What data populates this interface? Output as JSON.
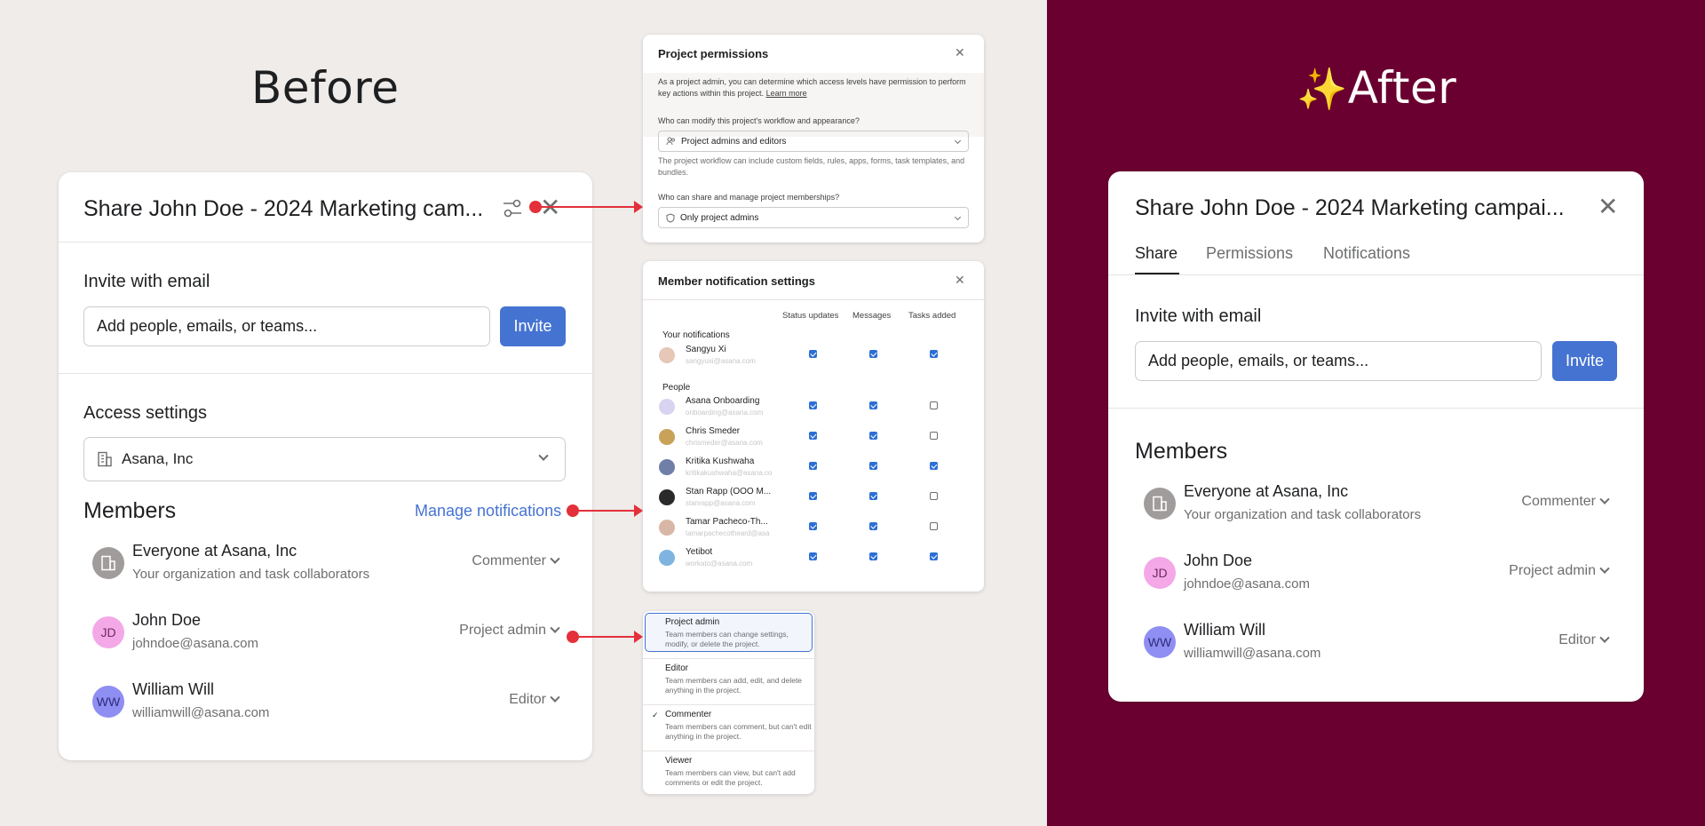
{
  "headings": {
    "before": "Before",
    "after_sparkle": "✨",
    "after": "After"
  },
  "before": {
    "title": "Share John Doe - 2024 Marketing cam...",
    "invite_label": "Invite with email",
    "invite_placeholder": "Add people, emails, or teams...",
    "invite_button": "Invite",
    "access_label": "Access settings",
    "access_value": "Asana, Inc",
    "members_label": "Members",
    "manage_notifications": "Manage notifications",
    "members": [
      {
        "name": "Everyone at Asana, Inc",
        "sub": "Your organization and task collaborators",
        "role": "Commenter",
        "initials": ""
      },
      {
        "name": "John Doe",
        "sub": "johndoe@asana.com",
        "role": "Project admin",
        "initials": "JD"
      },
      {
        "name": "William Will",
        "sub": "williamwill@asana.com",
        "role": "Editor",
        "initials": "WW"
      }
    ]
  },
  "permissions_panel": {
    "title": "Project permissions",
    "intro": "As a project admin, you can determine which access levels have permission to perform key actions within this project.",
    "learn_more": "Learn more",
    "q1": "Who can modify this project's workflow and appearance?",
    "q1_value": "Project admins and editors",
    "q1_note": "The project workflow can include custom fields, rules, apps, forms, task templates, and bundles.",
    "q2": "Who can share and manage project memberships?",
    "q2_value": "Only project admins"
  },
  "notifications_panel": {
    "title": "Member notification settings",
    "columns": [
      "Status updates",
      "Messages",
      "Tasks added"
    ],
    "your_section": "Your notifications",
    "people_section": "People",
    "rows": [
      {
        "name": "Sangyu Xi",
        "email": "sangyuxi@asana.com",
        "checks": [
          true,
          true,
          true
        ],
        "color": "#e6c7b8"
      },
      {
        "name": "Asana Onboarding",
        "email": "onboarding@asana.com",
        "checks": [
          true,
          true,
          false
        ],
        "color": "#d9d3f2"
      },
      {
        "name": "Chris Smeder",
        "email": "chrismeder@asana.com",
        "checks": [
          true,
          true,
          false
        ],
        "color": "#c9a25a"
      },
      {
        "name": "Kritika Kushwaha",
        "email": "kritikakushwaha@asana.co",
        "checks": [
          true,
          true,
          true
        ],
        "color": "#6f7fa8"
      },
      {
        "name": "Stan Rapp (OOO M...",
        "email": "stanrapp@asana.com",
        "checks": [
          true,
          true,
          false
        ],
        "color": "#2a2a2a"
      },
      {
        "name": "Tamar Pacheco-Th...",
        "email": "tamarpachecotheard@asa",
        "checks": [
          true,
          true,
          false
        ],
        "color": "#d9b7a6"
      },
      {
        "name": "Yetibot",
        "email": "workato@asana.com",
        "checks": [
          true,
          true,
          true
        ],
        "color": "#7fb3e0"
      }
    ]
  },
  "roles_panel": {
    "items": [
      {
        "title": "Project admin",
        "desc": "Team members can change settings, modify, or delete the project.",
        "selected": true,
        "checked": false
      },
      {
        "title": "Editor",
        "desc": "Team members can add, edit, and delete anything in the project.",
        "selected": false,
        "checked": false
      },
      {
        "title": "Commenter",
        "desc": "Team members can comment, but can't edit anything in the project.",
        "selected": false,
        "checked": true
      },
      {
        "title": "Viewer",
        "desc": "Team members can view, but can't add comments or edit the project.",
        "selected": false,
        "checked": false
      }
    ]
  },
  "after": {
    "title": "Share John Doe - 2024 Marketing campai...",
    "tabs": [
      "Share",
      "Permissions",
      "Notifications"
    ],
    "invite_label": "Invite with email",
    "invite_placeholder": "Add people, emails, or teams...",
    "invite_button": "Invite",
    "members_label": "Members",
    "members": [
      {
        "name": "Everyone at Asana, Inc",
        "sub": "Your organization and task collaborators",
        "role": "Commenter",
        "initials": ""
      },
      {
        "name": "John Doe",
        "sub": "johndoe@asana.com",
        "role": "Project admin",
        "initials": "JD"
      },
      {
        "name": "William Will",
        "sub": "williamwill@asana.com",
        "role": "Editor",
        "initials": "WW"
      }
    ]
  },
  "colors": {
    "accent": "#4573d2",
    "callout": "#e4303a",
    "after_bg": "#6a0030"
  }
}
